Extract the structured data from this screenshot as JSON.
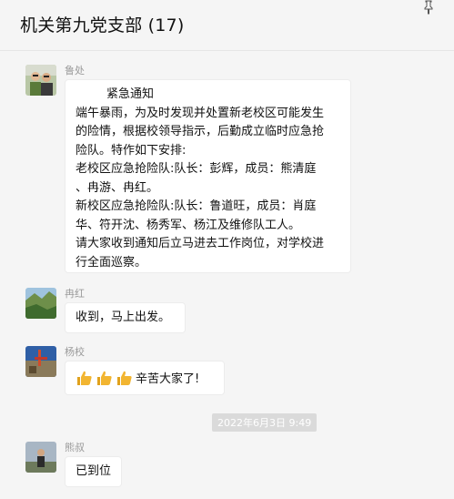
{
  "header": {
    "title": "机关第九党支部 (17)"
  },
  "messages": [
    {
      "sender": "鲁处",
      "lines": [
        "紧急通知",
        "端午暴雨，为及时发现并处置新老校区可能发生",
        "的险情，根据校领导指示，后勤成立临时应急抢",
        "险队。特作如下安排:",
        "老校区应急抢险队:队长：彭辉，成员：熊清庭",
        "、冉游、冉红。",
        "新校区应急抢险队:队长：鲁道旺，成员：肖庭",
        "华、符开沈、杨秀军、杨江及维修队工人。",
        "请大家收到通知后立马进去工作岗位，对学校进",
        "行全面巡察。"
      ]
    },
    {
      "sender": "冉红",
      "text": "收到，马上出发。"
    },
    {
      "sender": "杨校",
      "text": "辛苦大家了!",
      "emoji": [
        "thumbs-up",
        "thumbs-up",
        "thumbs-up"
      ]
    },
    {
      "sender": "熊叔",
      "text": "已到位"
    }
  ],
  "timestamp": "2022年6月3日 9:49",
  "colors": {
    "background": "#f5f5f5",
    "bubble": "#ffffff",
    "sender": "#9a9a9a",
    "timestamp_bg": "#dadada",
    "thumb": "#f2b531"
  }
}
